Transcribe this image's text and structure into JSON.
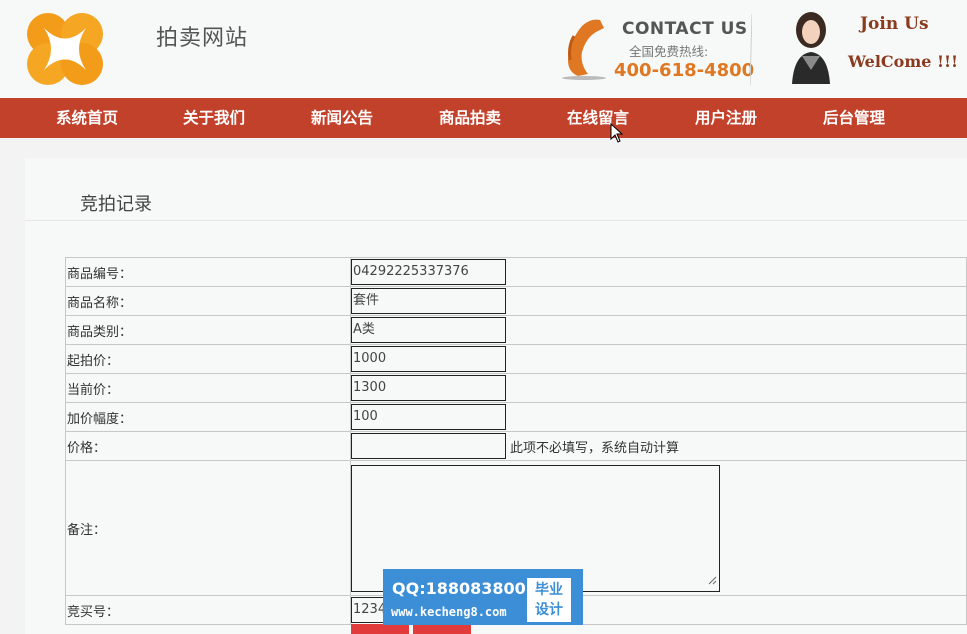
{
  "header": {
    "site_title": "拍卖网站",
    "contact_title": "CONTACT US",
    "contact_sub": "全国免费热线:",
    "contact_phone": "400-618-4800",
    "join_line1": "Join Us",
    "join_line2": "WelCome !!!"
  },
  "nav": {
    "items": [
      {
        "label": "系统首页"
      },
      {
        "label": "关于我们"
      },
      {
        "label": "新闻公告"
      },
      {
        "label": "商品拍卖"
      },
      {
        "label": "在线留言"
      },
      {
        "label": "用户注册"
      },
      {
        "label": "后台管理"
      }
    ]
  },
  "page": {
    "title": "竞拍记录"
  },
  "form": {
    "rows": [
      {
        "label": "商品编号：",
        "value": "04292225337376"
      },
      {
        "label": "商品名称：",
        "value": "套件"
      },
      {
        "label": "商品类别：",
        "value": "A类"
      },
      {
        "label": "起拍价：",
        "value": "1000"
      },
      {
        "label": "当前价：",
        "value": "1300"
      },
      {
        "label": "加价幅度：",
        "value": "100"
      },
      {
        "label": "价格：",
        "value": "",
        "hint": "此项不必填写，系统自动计算"
      },
      {
        "label": "备注：",
        "value": ""
      },
      {
        "label": "竞买号：",
        "value": "1234"
      }
    ]
  },
  "watermark": {
    "qq": "QQ:188083800",
    "url": "www.kecheng8.com",
    "box_line1": "毕业",
    "box_line2": "设计"
  },
  "colors": {
    "nav_bg": "#c2412a",
    "accent_orange": "#e07722",
    "join_text": "#8b3a1e",
    "button_red": "#e23b3b",
    "watermark_blue": "#3c8ed6"
  }
}
